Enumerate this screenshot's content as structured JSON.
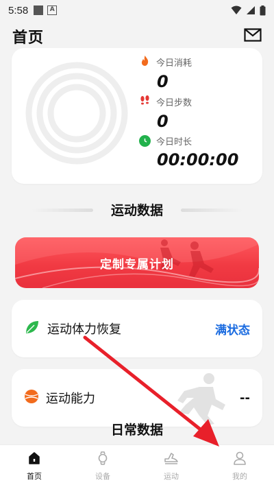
{
  "status_bar": {
    "time": "5:58"
  },
  "header": {
    "title": "首页"
  },
  "summary": {
    "calories": {
      "label": "今日消耗",
      "value": "0"
    },
    "steps": {
      "label": "今日步数",
      "value": "0"
    },
    "duration": {
      "label": "今日时长",
      "value": "00:00:00"
    }
  },
  "section": {
    "title": "运动数据"
  },
  "plan_banner": {
    "label": "定制专属计划"
  },
  "recovery": {
    "label": "运动体力恢复",
    "status": "满状态"
  },
  "ability": {
    "label": "运动能力",
    "value": "--"
  },
  "next_section": {
    "title": "日常数据"
  },
  "bottom_nav": {
    "items": [
      {
        "label": "首页",
        "icon": "home-icon",
        "active": true
      },
      {
        "label": "设备",
        "icon": "watch-icon",
        "active": false
      },
      {
        "label": "运动",
        "icon": "shoe-icon",
        "active": false
      },
      {
        "label": "我的",
        "icon": "person-icon",
        "active": false
      }
    ]
  },
  "colors": {
    "accent_red": "#f13a43",
    "status_blue": "#1a6be0",
    "calories_orange": "#f26b1d",
    "steps_red": "#e53935",
    "duration_green": "#22b14c",
    "leaf_green": "#2db84d",
    "ball_orange": "#f26b1d",
    "annotation_arrow": "#e8202a"
  }
}
